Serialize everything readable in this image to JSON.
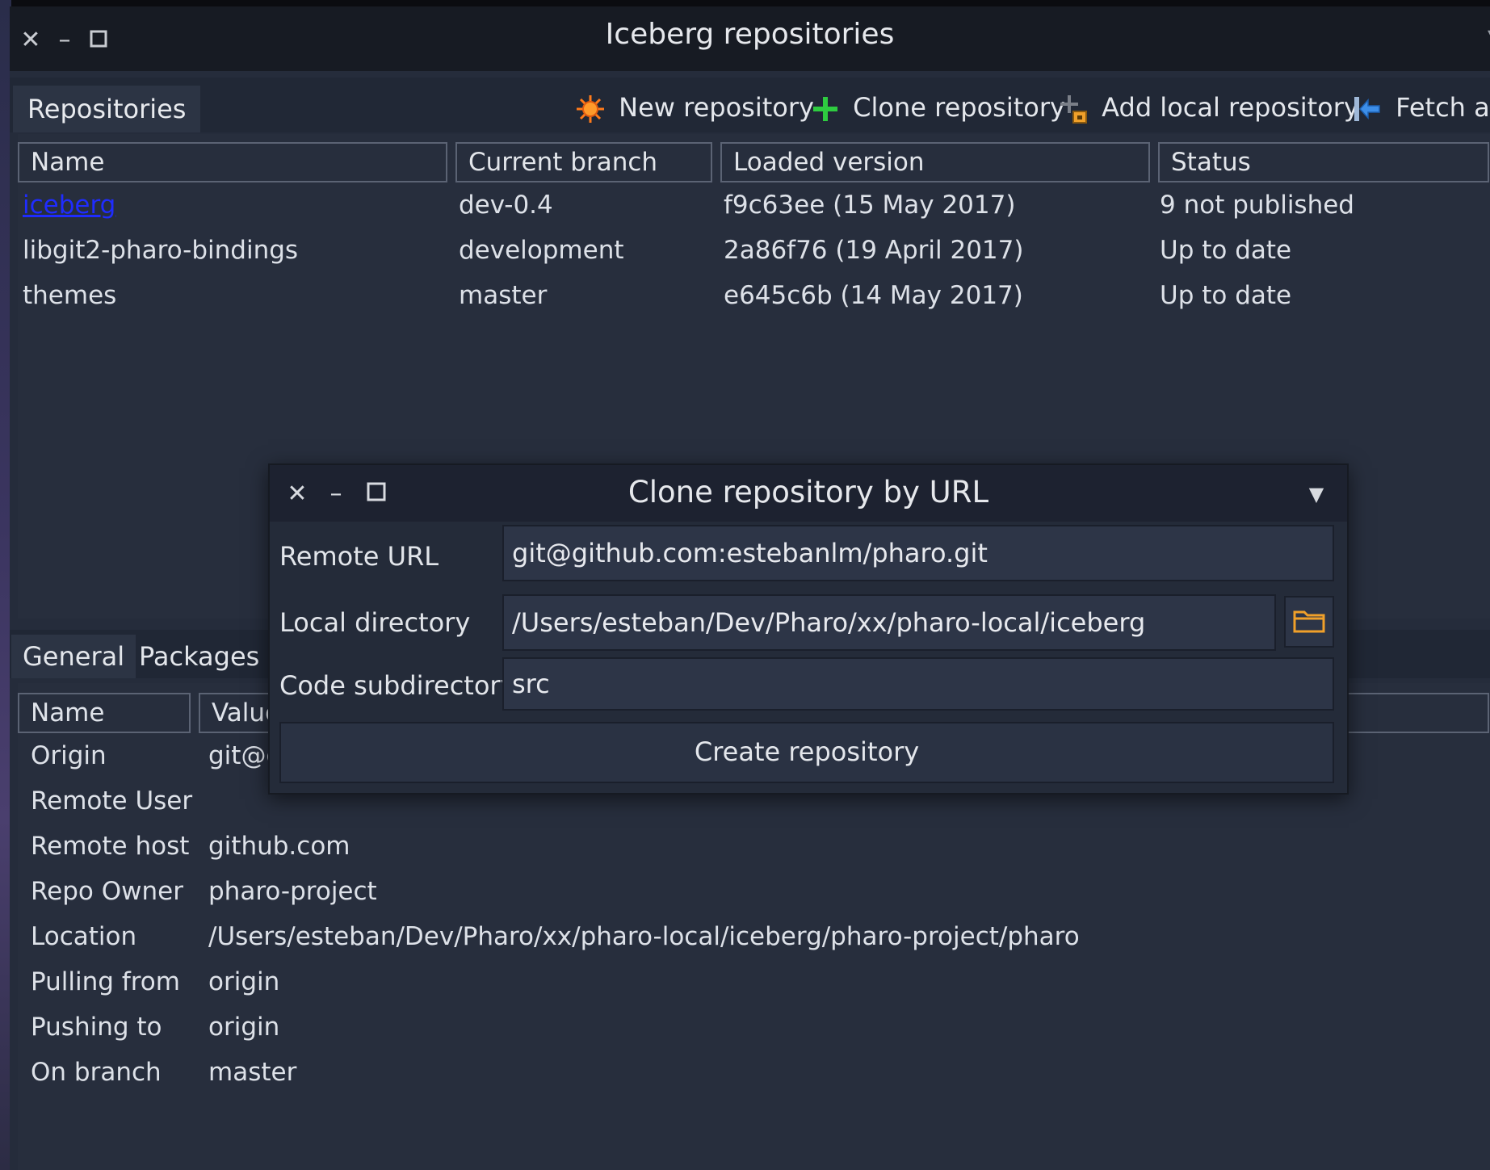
{
  "window": {
    "title": "Iceberg repositories"
  },
  "toolbar": {
    "tab_label": "Repositories",
    "new_repository": "New repository",
    "clone_repository": "Clone repository",
    "add_local_repository": "Add local repository",
    "fetch_all": "Fetch all"
  },
  "repositories": {
    "columns": [
      "Name",
      "Current branch",
      "Loaded version",
      "Status"
    ],
    "rows": [
      {
        "name": "iceberg",
        "branch": "dev-0.4",
        "version": "f9c63ee (15 May 2017)",
        "status": "9 not published"
      },
      {
        "name": "libgit2-pharo-bindings",
        "branch": "development",
        "version": "2a86f76 (19 April 2017)",
        "status": "Up to date"
      },
      {
        "name": "themes",
        "branch": "master",
        "version": "e645c6b (14 May 2017)",
        "status": "Up to date"
      }
    ]
  },
  "details": {
    "tabs": [
      "General",
      "Packages"
    ],
    "columns": [
      "Name",
      "Value"
    ],
    "rows": [
      {
        "label": "Origin",
        "value": "git@g"
      },
      {
        "label": "Remote User",
        "value": ""
      },
      {
        "label": "Remote host",
        "value": "github.com"
      },
      {
        "label": "Repo Owner",
        "value": "pharo-project"
      },
      {
        "label": "Location",
        "value": "/Users/esteban/Dev/Pharo/xx/pharo-local/iceberg/pharo-project/pharo"
      },
      {
        "label": "Pulling from",
        "value": "origin"
      },
      {
        "label": "Pushing to",
        "value": "origin"
      },
      {
        "label": "On branch",
        "value": "master"
      }
    ]
  },
  "dialog": {
    "title": "Clone repository by URL",
    "remote_url_label": "Remote URL",
    "remote_url_value": "git@github.com:estebanlm/pharo.git",
    "local_dir_label": "Local directory",
    "local_dir_value": "/Users/esteban/Dev/Pharo/xx/pharo-local/iceberg",
    "code_subdir_label": "Code subdirectory",
    "code_subdir_value": "src",
    "create_button": "Create repository"
  },
  "colors": {
    "link": "#1f2cff",
    "new_icon": "#ff7a1a",
    "clone_icon": "#2ecc40",
    "folder_icon": "#f0a02a",
    "fetch_icon": "#3d8ee8"
  }
}
